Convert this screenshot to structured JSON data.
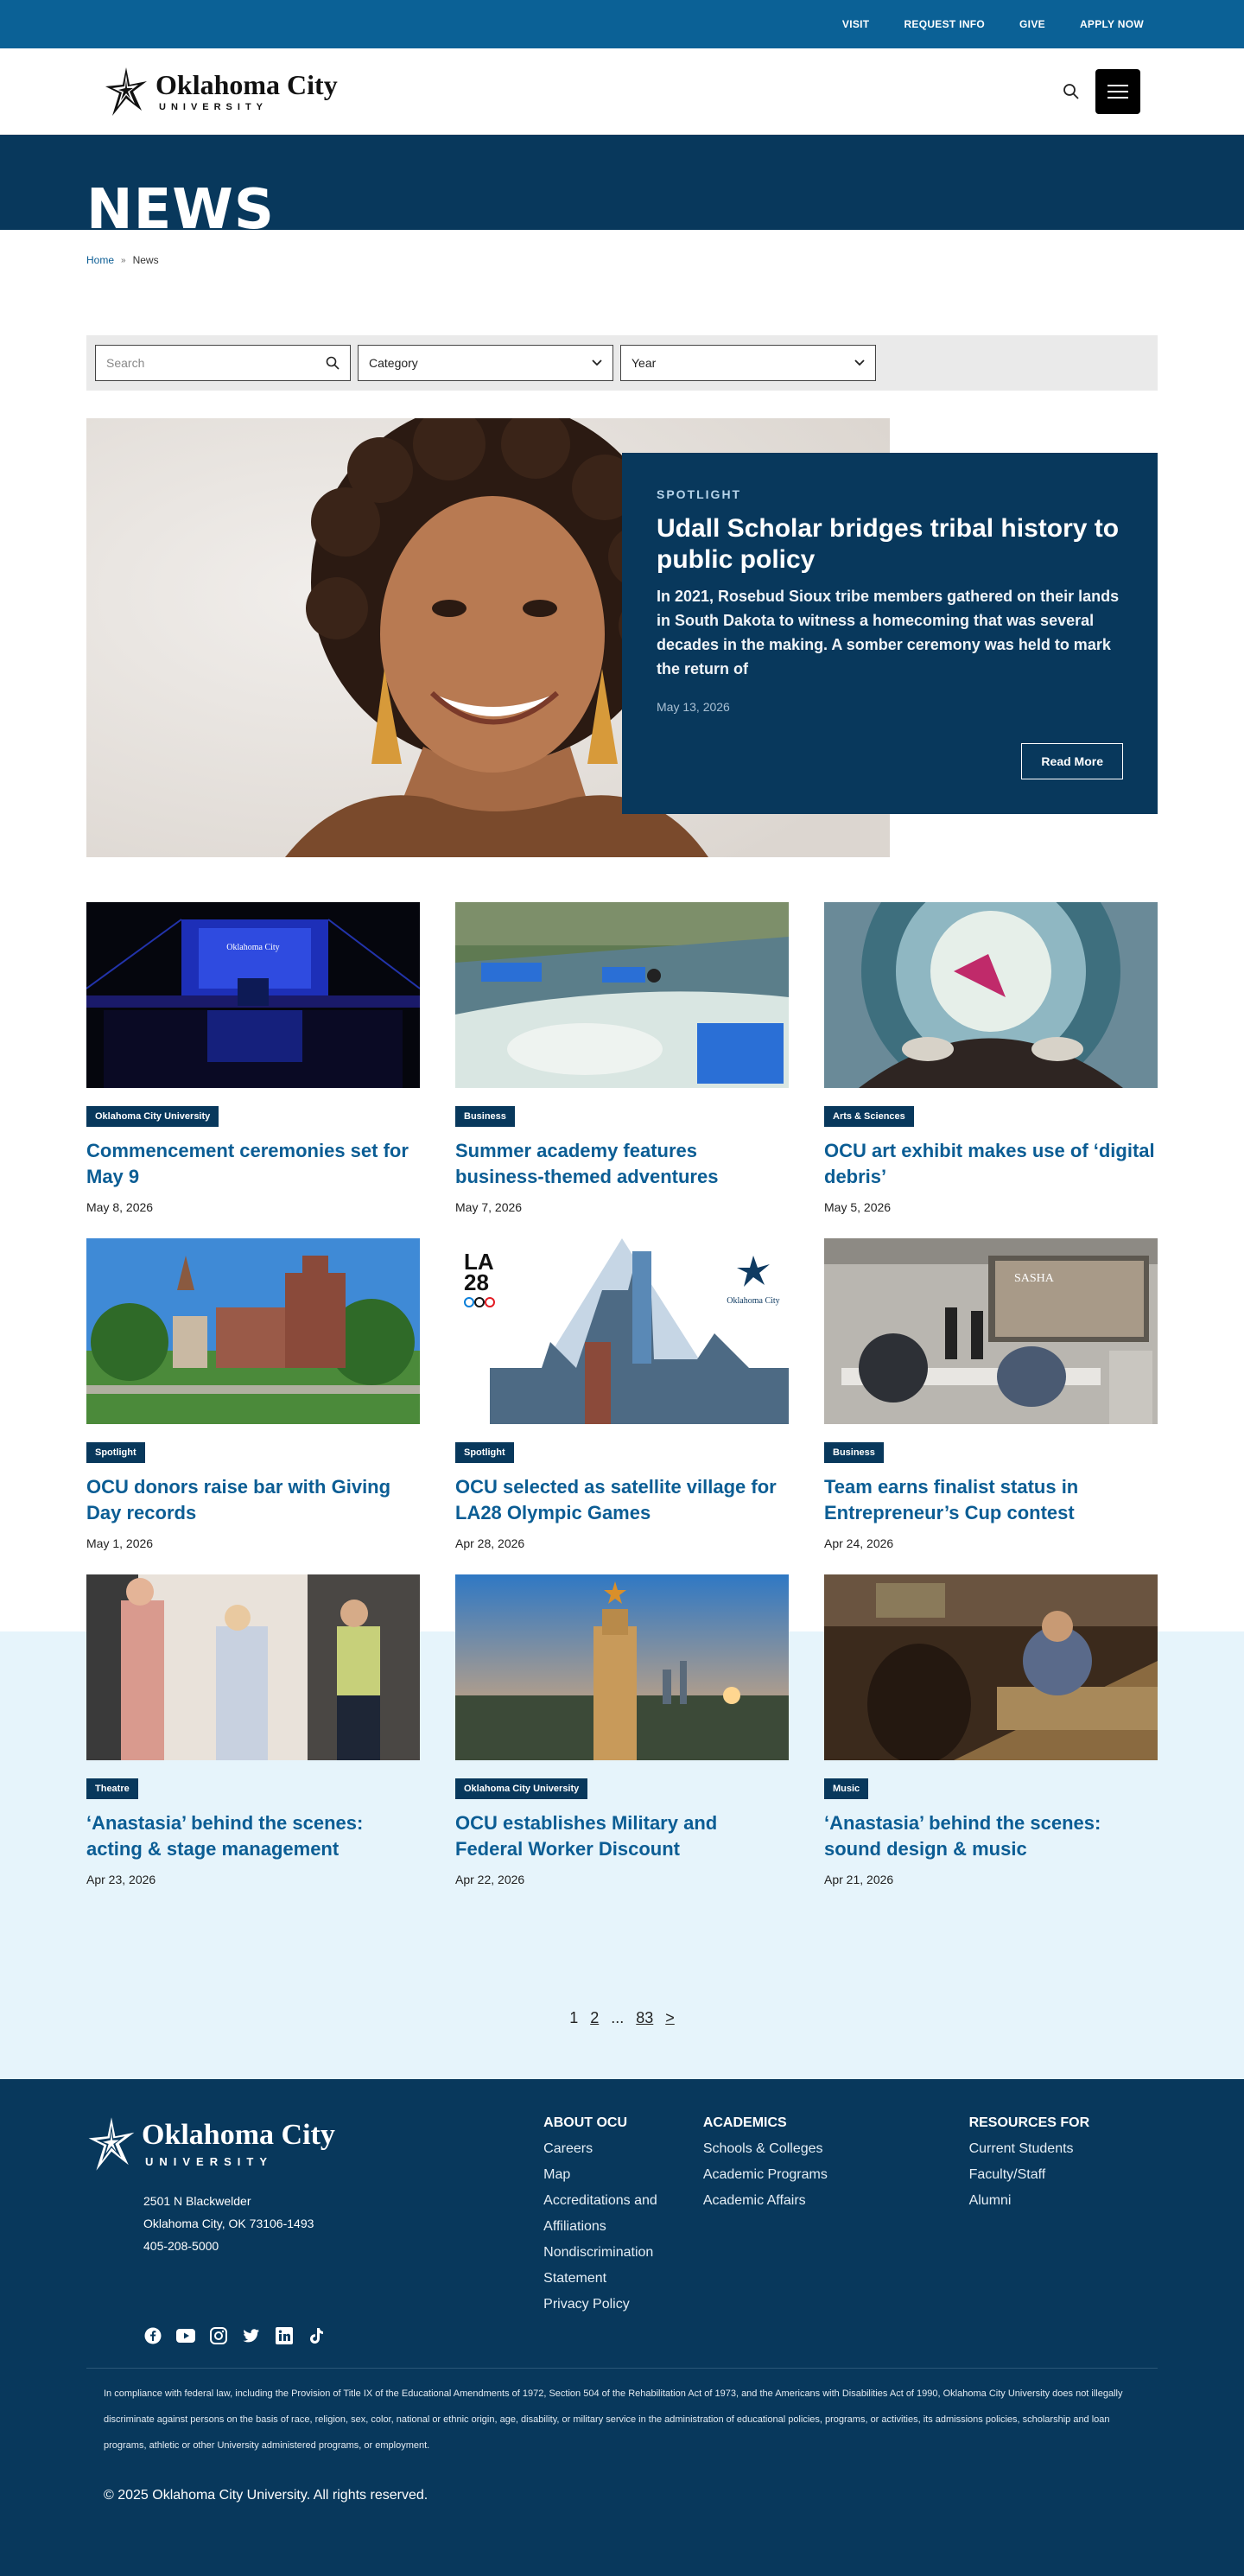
{
  "utility_nav": [
    "VISIT",
    "REQUEST INFO",
    "GIVE",
    "APPLY NOW"
  ],
  "logo": {
    "name": "Oklahoma City",
    "sub": "UNIVERSITY"
  },
  "page_title": "NEWS",
  "breadcrumb": {
    "home": "Home",
    "separator": "»",
    "current": "News"
  },
  "filters": {
    "search_placeholder": "Search",
    "category": "Category",
    "year": "Year"
  },
  "featured": {
    "kicker": "SPOTLIGHT",
    "title": "Udall Scholar bridges tribal history to public policy",
    "excerpt": "In 2021, Rosebud Sioux tribe members gathered on their lands in South Dakota to witness a homecoming that was several decades in the making. A somber ceremony was held to mark the return of",
    "date": "May 13, 2026",
    "button": "Read More"
  },
  "articles": [
    {
      "tag": "Oklahoma City University",
      "title": "Commencement ceremonies set for May 9",
      "date": "May 8, 2026"
    },
    {
      "tag": "Business",
      "title": "Summer academy features business-themed adventures",
      "date": "May 7, 2026"
    },
    {
      "tag": "Arts & Sciences",
      "title": "OCU art exhibit makes use of ‘digital debris’",
      "date": "May 5, 2026"
    },
    {
      "tag": "Spotlight",
      "title": "OCU donors raise bar with Giving Day records",
      "date": "May 1, 2026"
    },
    {
      "tag": "Spotlight",
      "title": "OCU selected as satellite village for LA28 Olympic Games",
      "date": "Apr 28, 2026"
    },
    {
      "tag": "Business",
      "title": "Team earns finalist status in Entrepreneur’s Cup contest",
      "date": "Apr 24, 2026"
    },
    {
      "tag": "Theatre",
      "title": "‘Anastasia’ behind the scenes: acting & stage management",
      "date": "Apr 23, 2026"
    },
    {
      "tag": "Oklahoma City University",
      "title": "OCU establishes Military and Federal Worker Discount",
      "date": "Apr 22, 2026"
    },
    {
      "tag": "Music",
      "title": "‘Anastasia’ behind the scenes: sound design & music",
      "date": "Apr 21, 2026"
    }
  ],
  "image_text": {
    "podium": "Oklahoma City",
    "la28_top": "LA",
    "la28_bottom": "28",
    "ocu_logo": "Oklahoma City",
    "slide": "SASHA"
  },
  "pagination": {
    "pages": [
      "1",
      "2",
      "...",
      "83",
      ">"
    ]
  },
  "footer": {
    "address": [
      "2501 N Blackwelder",
      "Oklahoma City, OK 73106-1493",
      "405-208-5000"
    ],
    "columns": [
      {
        "heading": "ABOUT OCU",
        "links": [
          "Careers",
          "Map",
          "Accreditations and Affiliations",
          "Nondiscrimination Statement",
          "Privacy Policy"
        ]
      },
      {
        "heading": "ACADEMICS",
        "links": [
          "Schools & Colleges",
          "Academic Programs",
          "Academic Affairs"
        ]
      },
      {
        "heading": "RESOURCES FOR",
        "links": [
          "Current Students",
          "Faculty/Staff",
          "Alumni"
        ]
      }
    ],
    "socials": [
      "facebook-icon",
      "youtube-icon",
      "instagram-icon",
      "twitter-icon",
      "linkedin-icon",
      "tiktok-icon"
    ],
    "legal": "In compliance with federal law, including the Provision of Title IX of the Educational Amendments of 1972, Section 504 of the Rehabilitation Act of 1973, and the Americans with Disabilities Act of 1990, Oklahoma City University does not illegally discriminate against persons on the basis of race, religion, sex, color, national or ethnic origin, age, disability, or military service in the administration of educational policies, programs, or activities, its admissions policies, scholarship and loan programs, athletic or other University administered programs, or employment.",
    "copyright": "© 2025 Oklahoma City University. All rights reserved."
  },
  "colors": {
    "navy": "#08385c",
    "utility_blue": "#0b6196",
    "link_blue": "#0b5d94",
    "light_bg": "#e6f4fb"
  }
}
